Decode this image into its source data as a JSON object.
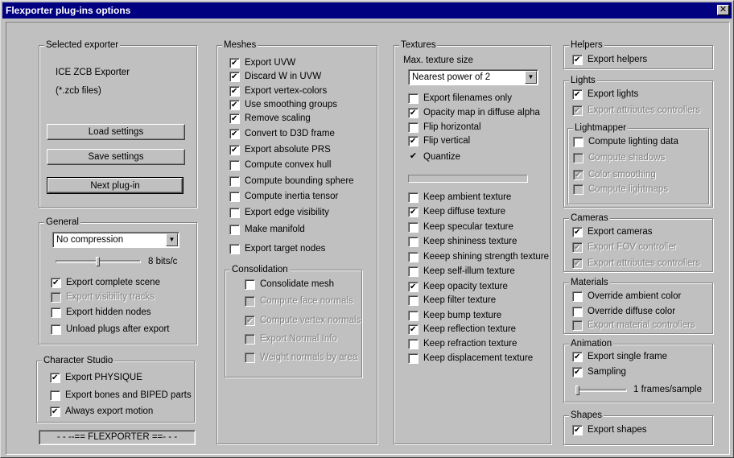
{
  "window": {
    "title": "Flexporter plug-ins options",
    "close": "✕"
  },
  "selected_exporter": {
    "group": "Selected exporter",
    "name": "ICE ZCB Exporter",
    "files": "(*.zcb files)",
    "load": "Load settings",
    "save": "Save settings",
    "next": "Next plug-in"
  },
  "general": {
    "group": "General",
    "compression": "No compression",
    "bits": "8 bits/c",
    "bits_level": 0.5,
    "export_complete_scene": "Export complete scene",
    "export_visibility_tracks": "Export visibility tracks",
    "export_hidden_nodes": "Export hidden nodes",
    "unload_plugs": "Unload plugs after export"
  },
  "character_studio": {
    "group": "Character Studio",
    "export_physique": "Export PHYSIQUE",
    "export_bones": "Export bones and BIPED parts",
    "always_export_motion": "Always export motion"
  },
  "banner": "- - --== FLEXPORTER ==- - -",
  "meshes": {
    "group": "Meshes",
    "items": [
      {
        "label": "Export UVW",
        "checked": true
      },
      {
        "label": "Discard W in UVW",
        "checked": true
      },
      {
        "label": "Export vertex-colors",
        "checked": true
      },
      {
        "label": "Use smoothing groups",
        "checked": true
      },
      {
        "label": "Remove scaling",
        "checked": true
      },
      {
        "label": "Convert to D3D frame",
        "checked": true
      },
      {
        "label": "Export absolute PRS",
        "checked": true
      },
      {
        "label": "Compute convex hull",
        "checked": false
      },
      {
        "label": "Compute bounding sphere",
        "checked": false
      },
      {
        "label": "Compute inertia tensor",
        "checked": false
      },
      {
        "label": "Export edge visibility",
        "checked": false
      },
      {
        "label": "Make manifold",
        "checked": false
      },
      {
        "label": "Export target nodes",
        "checked": false
      }
    ],
    "consolidation": {
      "group": "Consolidation",
      "consolidate_mesh": "Consolidate mesh",
      "compute_face_normals": "Compute face normals",
      "compute_vertex_normals": "Compute vertex normals",
      "export_normal_info": "Export Normal Info",
      "weight_normals": "Weight normals by area"
    }
  },
  "textures": {
    "group": "Textures",
    "max_size_label": "Max. texture size",
    "max_size_value": "Nearest power of 2",
    "export_filenames_only": "Export filenames only",
    "opacity_map": "Opacity map in diffuse alpha",
    "flip_horizontal": "Flip horizontal",
    "flip_vertical": "Flip vertical",
    "quantize": "Quantize",
    "keep": [
      {
        "label": "Keep ambient texture",
        "checked": false
      },
      {
        "label": "Keep diffuse texture",
        "checked": true
      },
      {
        "label": "Keep specular texture",
        "checked": false
      },
      {
        "label": "Keep shininess texture",
        "checked": false
      },
      {
        "label": "Keeep shining strength texture",
        "checked": false
      },
      {
        "label": "Keep self-illum texture",
        "checked": false
      },
      {
        "label": "Keep opacity texture",
        "checked": true
      },
      {
        "label": "Keep filter texture",
        "checked": false
      },
      {
        "label": "Keep bump texture",
        "checked": false
      },
      {
        "label": "Keep reflection texture",
        "checked": true
      },
      {
        "label": "Keep refraction texture",
        "checked": false
      },
      {
        "label": "Keep displacement texture",
        "checked": false
      }
    ]
  },
  "helpers": {
    "group": "Helpers",
    "export_helpers": "Export helpers"
  },
  "lights": {
    "group": "Lights",
    "export_lights": "Export lights",
    "export_attr_controllers": "Export attributes controllers",
    "lightmapper": {
      "group": "Lightmapper",
      "compute_lighting_data": "Compute lighting data",
      "compute_shadows": "Compute shadows",
      "color_smoothing": "Color smoothing",
      "compute_lightmaps": "Compute lightmaps"
    }
  },
  "cameras": {
    "group": "Cameras",
    "export_cameras": "Export cameras",
    "export_fov": "Export FOV controller",
    "export_attr_controllers": "Export attributes controllers"
  },
  "materials": {
    "group": "Materials",
    "override_ambient": "Override ambient color",
    "override_diffuse": "Override diffuse color",
    "export_material_controllers": "Export material controllers"
  },
  "animation": {
    "group": "Animation",
    "export_single_frame": "Export single frame",
    "sampling": "Sampling",
    "frames_sample": "1 frames/sample",
    "sampling_level": 0.0
  },
  "shapes": {
    "group": "Shapes",
    "export_shapes": "Export shapes"
  }
}
